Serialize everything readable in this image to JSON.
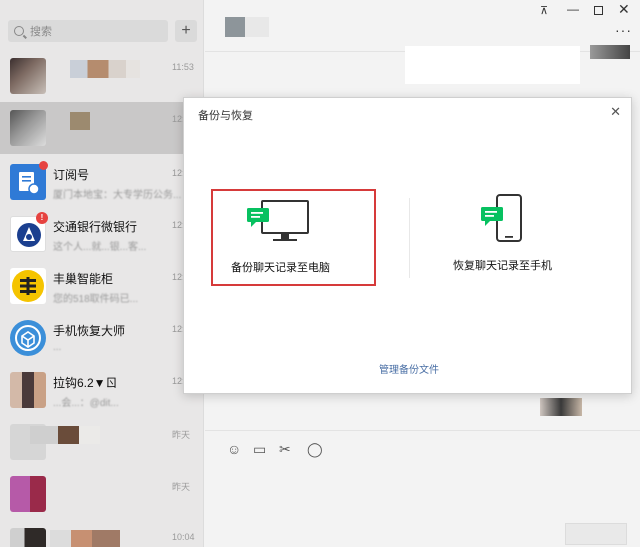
{
  "sidebar": {
    "search_placeholder": "搜索",
    "add_button": "+",
    "chats": [
      {
        "name": "",
        "message": "",
        "time": "11:53"
      },
      {
        "name": "",
        "message": "",
        "time": "12:"
      },
      {
        "name": "订阅号",
        "message": "厦门本地宝：大专学历公务...",
        "time": "12:"
      },
      {
        "name": "交通银行微银行",
        "message": "这个人...就...银...客...",
        "time": "12:"
      },
      {
        "name": "丰巢智能柜",
        "message": "您的518取件码已...",
        "time": "12:"
      },
      {
        "name": "手机恢复大师",
        "message": "...",
        "time": "12:"
      },
      {
        "name": "拉钩6.2▼ㄖ",
        "message": "...会...：@dit...",
        "time": "12:"
      },
      {
        "name": "",
        "message": "",
        "time": "昨天"
      },
      {
        "name": "",
        "message": "",
        "time": "昨天"
      },
      {
        "name": "",
        "message": "",
        "time": "10:04"
      }
    ]
  },
  "window": {
    "pin": "⊼",
    "minimize": "—",
    "close": "✕",
    "more": "···"
  },
  "toolbar": {
    "emoji": "☺",
    "folder": "▭",
    "scissors": "✂",
    "chat": "◯"
  },
  "modal": {
    "title": "备份与恢复",
    "close": "✕",
    "backup_label": "备份聊天记录至电脑",
    "restore_label": "恢复聊天记录至手机",
    "manage_link": "管理备份文件"
  },
  "colors": {
    "accent_green": "#07c160",
    "highlight_red": "#d63a3a",
    "link_blue": "#4a6fa5"
  }
}
